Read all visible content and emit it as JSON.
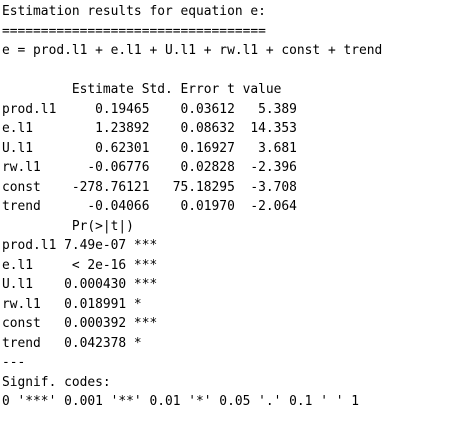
{
  "output": {
    "heading": "Estimation results for equation e:",
    "rule": "==================================",
    "equation": "e = prod.l1 + e.l1 + U.l1 + rw.l1 + const + trend",
    "blank_1": "",
    "coef_header": "         Estimate Std. Error t value",
    "coef_rows": [
      "prod.l1     0.19465    0.03612   5.389",
      "e.l1        1.23892    0.08632  14.353",
      "U.l1        0.62301    0.16927   3.681",
      "rw.l1      -0.06776    0.02828  -2.396",
      "const    -278.76121   75.18295  -3.708",
      "trend      -0.04066    0.01970  -2.064"
    ],
    "p_header": "         Pr(>|t|)",
    "p_rows": [
      "prod.l1 7.49e-07 ***",
      "e.l1     < 2e-16 ***",
      "U.l1    0.000430 ***",
      "rw.l1   0.018991 *",
      "const   0.000392 ***",
      "trend   0.042378 *"
    ],
    "separator": "---",
    "signif_label": "Signif. codes:",
    "signif_codes": "0 '***' 0.001 '**' 0.01 '*' 0.05 '.' 0.1 ' ' 1"
  }
}
